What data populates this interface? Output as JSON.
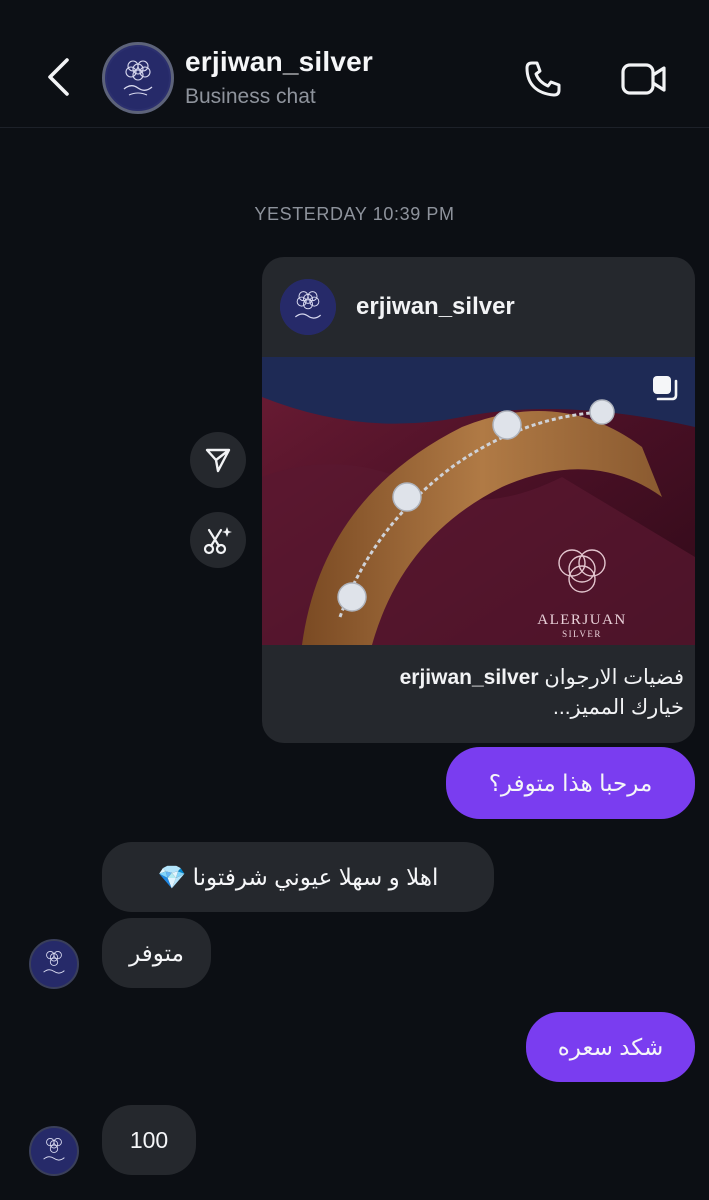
{
  "header": {
    "title": "erjiwan_silver",
    "subtitle": "Business chat",
    "avatar_icon": "brand-logo-icon",
    "back_icon": "chevron-left-icon",
    "call_icon": "phone-icon",
    "video_icon": "video-camera-icon"
  },
  "timestamp": "YESTERDAY 10:39 PM",
  "post": {
    "username": "erjiwan_silver",
    "caption_user": "erjiwan_silver",
    "caption_text": "فضيات الارجوان",
    "caption_line2": "خيارك المميز...",
    "brand_name": "ALERJUAN",
    "brand_sub": "SILVER",
    "multi_icon": "carousel-icon"
  },
  "side_actions": {
    "share_icon": "send-icon",
    "remix_icon": "scissors-sparkle-icon"
  },
  "messages": [
    {
      "direction": "out",
      "text": "مرحبا هذا متوفر؟"
    },
    {
      "direction": "in",
      "text": "اهلا و سهلا عيوني شرفتونا 💎"
    },
    {
      "direction": "in",
      "text": "متوفر"
    },
    {
      "direction": "out",
      "text": "شكد سعره"
    },
    {
      "direction": "in",
      "text": "100"
    }
  ],
  "colors": {
    "background": "#0c0f14",
    "outgoing_bubble": "#7a3df0",
    "incoming_bubble": "#25282d",
    "muted_text": "#8e939c"
  }
}
